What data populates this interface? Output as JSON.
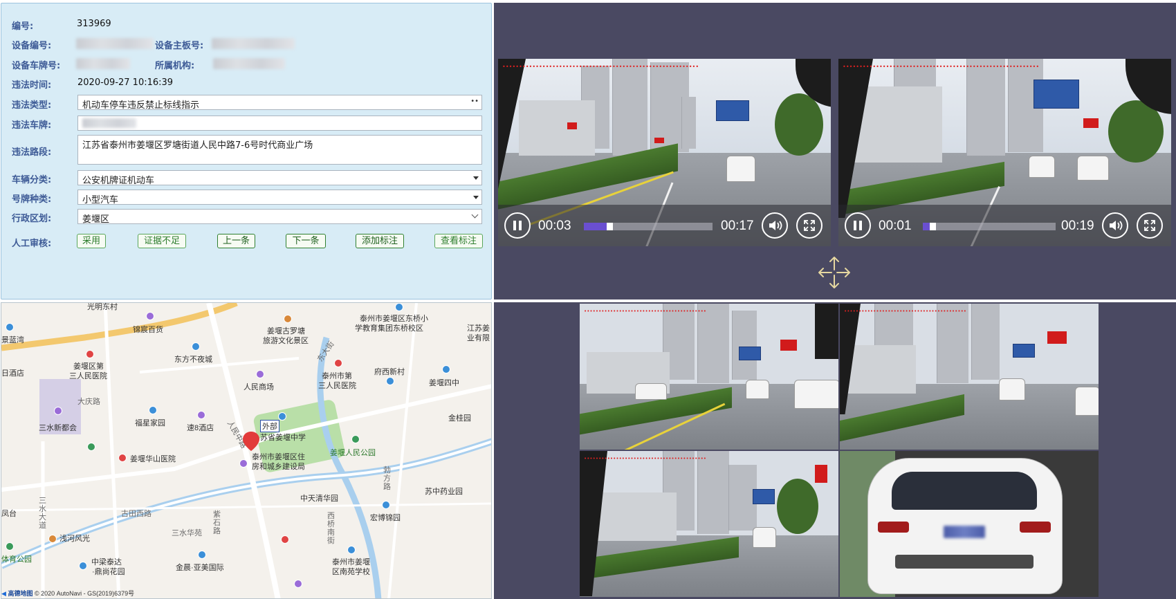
{
  "form": {
    "id_label": "编号:",
    "id_value": "313969",
    "device_no_label": "设备编号:",
    "mainboard_label": "设备主板号:",
    "plate_device_label": "设备车牌号:",
    "org_label": "所属机构:",
    "time_label": "违法时间:",
    "time_value": "2020-09-27 10:16:39",
    "type_label": "违法类型:",
    "type_value": "机动车停车违反禁止标线指示",
    "plate_label": "违法车牌:",
    "road_label": "违法路段:",
    "road_value": "江苏省泰州市姜堰区罗塘街道人民中路7-6号时代商业广场",
    "vehicle_class_label": "车辆分类:",
    "vehicle_class_value": "公安机牌证机动车",
    "plate_type_label": "号牌种类:",
    "plate_type_value": "小型汽车",
    "district_label": "行政区划:",
    "district_value": "姜堰区",
    "review_label": "人工审核:"
  },
  "buttons": {
    "adopt": "采用",
    "insufficient": "证据不足",
    "prev": "上一条",
    "next": "下一条",
    "add_mark": "添加标注",
    "view_mark": "查看标注"
  },
  "videos": [
    {
      "current": "00:03",
      "duration": "00:17",
      "progress": 0.176
    },
    {
      "current": "00:01",
      "duration": "00:19",
      "progress": 0.053
    }
  ],
  "map": {
    "labels": {
      "guangming": "光明东村",
      "jingrong": "锦宸百货",
      "jiangyan_luotang": "姜堰古罗塘",
      "luotang2": "旅游文化景区",
      "dongqiao_school": "泰州市姜堰区东桥小",
      "dongqiao_school2": "学教育集团东桥校区",
      "jiangsu": "江苏姜",
      "jiangsu2": "业有限",
      "lanwan": "景蓝湾",
      "hospital3": "姜堰区第",
      "hospital3b": "三人民医院",
      "dongfang": "东方不夜城",
      "jiudian": "日酒店",
      "renmin_mall": "人民商场",
      "taizhou_hosp": "泰州市第",
      "taizhou_hosp2": "三人民医院",
      "fuxi": "府西新村",
      "jiangyan4": "姜堰四中",
      "daqing": "大庆路",
      "sanshui": "三水新都会",
      "fuxing": "福星家园",
      "su8": "速8酒店",
      "waibu": "外部",
      "middle_school": "苏省姜堰中学",
      "renmin_park": "姜堰人民公园",
      "jinguiyuan": "金桂园",
      "huashan": "姜堰华山医院",
      "housing": "泰州市姜堰区住",
      "housing2": "房和城乡建设局",
      "sanshui_road": "三水大道",
      "zhongtian": "中天清华园",
      "suzhong": "苏中药业园",
      "gutian": "古田西路",
      "sanshui_huayuan": "三水华苑",
      "ziyun": "紫石路",
      "xiqiao": "西桥南街",
      "hongbo": "宏博锦园",
      "fenghe": "凤台",
      "fenghe2": "浅河风光",
      "zhongliang": "中梁泰达",
      "zhongliang2": "·鼎尚花园",
      "jinchen": "金晨·亚美国际",
      "south_school": "泰州市姜堰",
      "south_school2": "区南苑学校",
      "sports_park": "体育公园",
      "dongdajie": "东大街",
      "renmin_road": "人民中路",
      "bicycle": "勃方路"
    },
    "footer_logo": "高德地图",
    "footer_copy": "© 2020 AutoNavi - GS(2019)6379号"
  },
  "colors": {
    "form_bg": "#d8ecf6",
    "label_blue": "#3d5a96",
    "dark_panel": "#4a4962",
    "progress_purple": "#6a4fd1",
    "button_green": "#2d7d2d",
    "move_icon": "#e6d7a0"
  },
  "icons": [
    "pause-icon",
    "volume-icon",
    "fullscreen-icon",
    "move-arrows-icon",
    "map-pin-icon"
  ]
}
